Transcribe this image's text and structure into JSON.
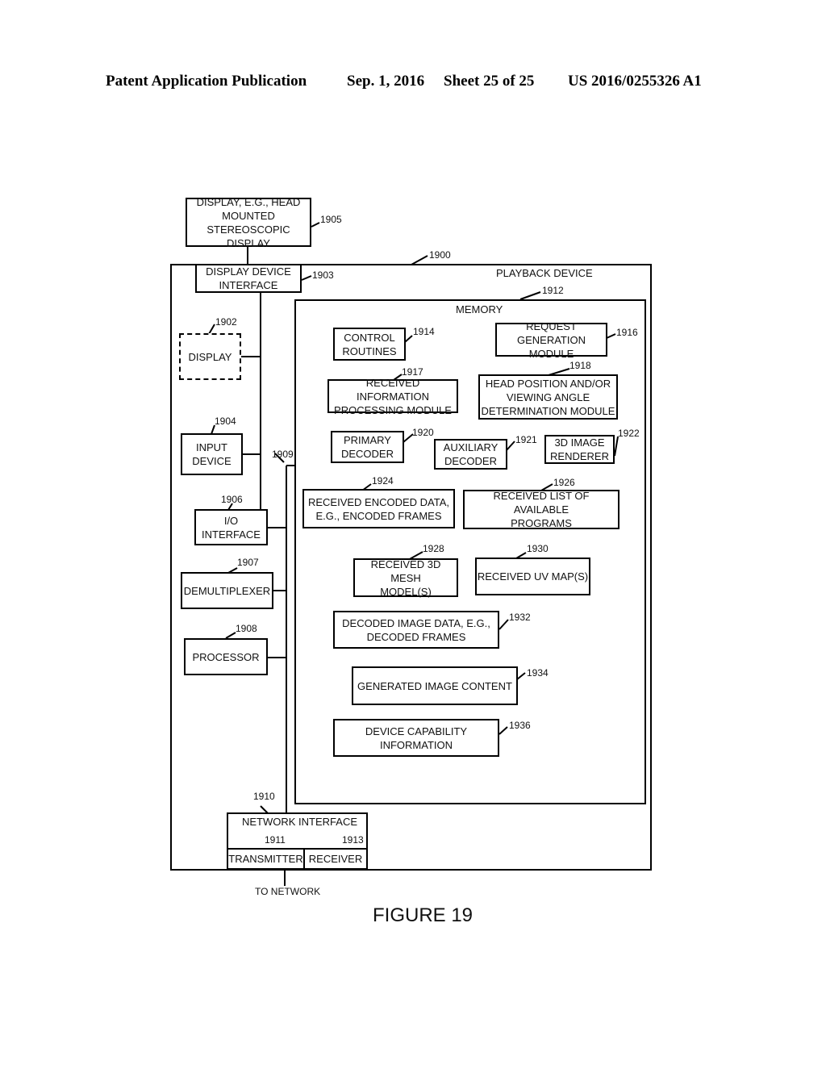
{
  "header": {
    "publication": "Patent Application Publication",
    "date": "Sep. 1, 2016",
    "sheet": "Sheet 25 of 25",
    "number": "US 2016/0255326 A1"
  },
  "figure_label": "FIGURE 19",
  "external_display": {
    "label": "DISPLAY, E.G., HEAD\nMOUNTED\nSTEREOSCOPIC DISPLAY",
    "ref": "1905"
  },
  "playback_device": {
    "label": "PLAYBACK DEVICE",
    "ref": "1900"
  },
  "display_device_interface": {
    "label": "DISPLAY DEVICE\nINTERFACE",
    "ref": "1903"
  },
  "display": {
    "label": "DISPLAY",
    "ref": "1902"
  },
  "input_device": {
    "label": "INPUT\nDEVICE",
    "ref": "1904"
  },
  "io_interface": {
    "label": "I/O\nINTERFACE",
    "ref": "1906"
  },
  "demultiplexer": {
    "label": "DEMULTIPLEXER",
    "ref": "1907"
  },
  "processor": {
    "label": "PROCESSOR",
    "ref": "1908"
  },
  "bus": {
    "ref": "1909"
  },
  "network_interface": {
    "label": "NETWORK INTERFACE",
    "ref": "1910"
  },
  "transmitter": {
    "label": "TRANSMITTER",
    "ref": "1911"
  },
  "receiver": {
    "label": "RECEIVER",
    "ref": "1913"
  },
  "to_network": "TO NETWORK",
  "memory": {
    "label": "MEMORY",
    "ref": "1912",
    "modules": [
      {
        "label": "CONTROL\nROUTINES",
        "ref": "1914"
      },
      {
        "label": "REQUEST\nGENERATION MODULE",
        "ref": "1916"
      },
      {
        "label": "RECEIVED INFORMATION\nPROCESSING MODULE",
        "ref": "1917"
      },
      {
        "label": "HEAD POSITION AND/OR\nVIEWING ANGLE\nDETERMINATION MODULE",
        "ref": "1918"
      },
      {
        "label": "PRIMARY\nDECODER",
        "ref": "1920"
      },
      {
        "label": "AUXILIARY\nDECODER",
        "ref": "1921"
      },
      {
        "label": "3D IMAGE\nRENDERER",
        "ref": "1922"
      },
      {
        "label": "RECEIVED ENCODED DATA,\nE.G., ENCODED FRAMES",
        "ref": "1924"
      },
      {
        "label": "RECEIVED LIST OF AVAILABLE\nPROGRAMS",
        "ref": "1926"
      },
      {
        "label": "RECEIVED 3D MESH\nMODEL(S)",
        "ref": "1928"
      },
      {
        "label": "RECEIVED UV MAP(S)",
        "ref": "1930"
      },
      {
        "label": "DECODED IMAGE DATA, E.G.,\nDECODED FRAMES",
        "ref": "1932"
      },
      {
        "label": "GENERATED IMAGE CONTENT",
        "ref": "1934"
      },
      {
        "label": "DEVICE CAPABILITY\nINFORMATION",
        "ref": "1936"
      }
    ]
  }
}
